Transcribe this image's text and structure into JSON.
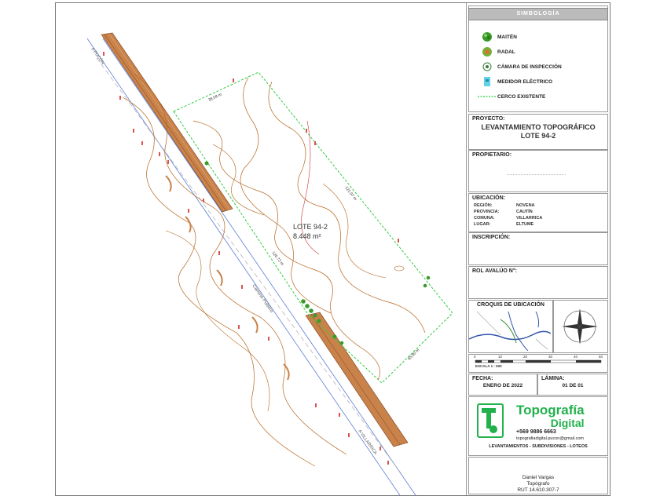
{
  "map": {
    "lot_name": "LOTE 94-2",
    "lot_area": "8.448 m²",
    "road_label": "Camino Público",
    "labels_top": "A PUCÓN",
    "labels_bottom": "A VILLARRICA",
    "dim_top": "38.58 m",
    "dim_right": "121.97 m",
    "dim_left": "120.73 m",
    "dim_bottom": "65.80 m",
    "colors": {
      "boundary": "#2ecc40",
      "contour": "#b5651d",
      "road": "#5a7fd6",
      "asphalt": "#c9824a",
      "tree": "#3a9a2a"
    }
  },
  "legend": {
    "title": "SIMBOLOGÍA",
    "items": [
      {
        "icon": "maiten-tree-icon",
        "label": "MAITÉN"
      },
      {
        "icon": "radal-tree-icon",
        "label": "RADAL"
      },
      {
        "icon": "inspection-chamber-icon",
        "label": "CÁMARA DE INSPECCIÓN"
      },
      {
        "icon": "electric-meter-icon",
        "label": "MEDIDOR ELÉCTRICO"
      },
      {
        "icon": "existing-fence-icon",
        "label": "CERCO EXISTENTE"
      }
    ]
  },
  "project": {
    "label": "PROYECTO:",
    "line1": "LEVANTAMIENTO TOPOGRÁFICO",
    "line2": "LOTE 94-2"
  },
  "owner": {
    "label": "PROPIETARIO:"
  },
  "location": {
    "label": "UBICACIÓN:",
    "rows": [
      {
        "k": "REGIÓN:",
        "v": "NOVENA"
      },
      {
        "k": "PROVINCIA:",
        "v": "CAUTÍN"
      },
      {
        "k": "COMUNA:",
        "v": "VILLARRICA"
      },
      {
        "k": "LUGAR:",
        "v": "ELTUME"
      }
    ]
  },
  "inscription": {
    "label": "INSCRIPCIÓN:"
  },
  "rol": {
    "label": "ROL AVALÚO N°:"
  },
  "croquis": {
    "label": "CROQUIS DE UBICACIÓN"
  },
  "scale": {
    "ticks": [
      "0",
      "10",
      "20",
      "30",
      "40",
      "50"
    ],
    "label": "ESCALA 1 : 500"
  },
  "date": {
    "label": "FECHA:",
    "value": "ENERO DE 2022"
  },
  "sheet": {
    "label": "LÁMINA:",
    "value": "01 DE 01"
  },
  "company": {
    "name1": "Topografía",
    "name2": "Digital",
    "phone": "+569 9886 6663",
    "email": "topografiadigital.pucon@gmail.com",
    "services": "LEVANTAMIENTOS - SUBDIVISIONES - LOTEOS"
  },
  "signature": {
    "name": "Daniel Vargas",
    "title": "Topógrafo",
    "rut": "RUT 14.610.307-7"
  }
}
